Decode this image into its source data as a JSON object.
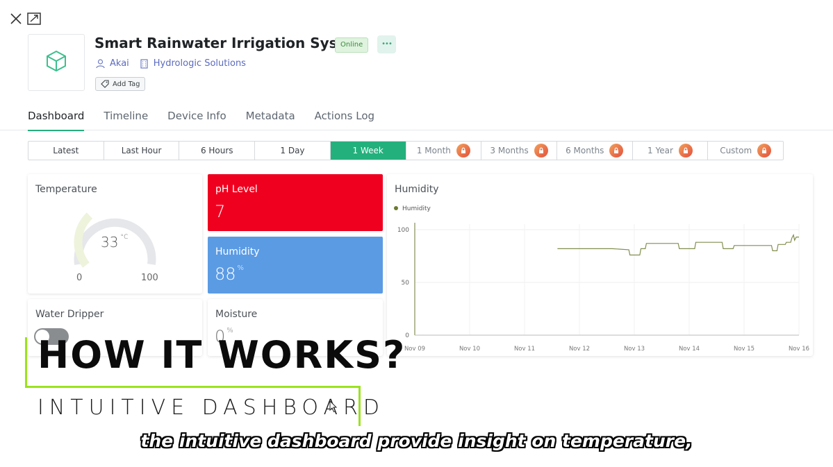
{
  "window_controls": {
    "close_icon": "close-icon",
    "expand_icon": "expand-icon"
  },
  "device": {
    "title": "Smart Rainwater Irrigation System",
    "status": "Online",
    "owner": "Akai",
    "organization": "Hydrologic Solutions",
    "add_tag_label": "Add Tag",
    "more_label": "•••",
    "icon": "cube-icon"
  },
  "tabs": [
    {
      "label": "Dashboard",
      "active": true
    },
    {
      "label": "Timeline"
    },
    {
      "label": "Device Info"
    },
    {
      "label": "Metadata"
    },
    {
      "label": "Actions Log"
    }
  ],
  "time_ranges": [
    {
      "label": "Latest"
    },
    {
      "label": "Last Hour"
    },
    {
      "label": "6 Hours"
    },
    {
      "label": "1 Day"
    },
    {
      "label": "1 Week",
      "active": true
    },
    {
      "label": "1 Month",
      "locked": true
    },
    {
      "label": "3 Months",
      "locked": true
    },
    {
      "label": "6 Months",
      "locked": true
    },
    {
      "label": "1 Year",
      "locked": true
    },
    {
      "label": "Custom",
      "locked": true
    }
  ],
  "widgets": {
    "temperature": {
      "title": "Temperature",
      "value": "33",
      "unit": "°C",
      "min": "0",
      "max": "100",
      "level": 0.33
    },
    "ph": {
      "title": "pH Level",
      "value": "7",
      "color": "#f0001f"
    },
    "humidity_tile": {
      "title": "Humidity",
      "value": "88",
      "unit": "%",
      "color": "#5b9be4"
    },
    "water_dripper": {
      "title": "Water Dripper",
      "on": false
    },
    "moisture": {
      "title": "Moisture",
      "value": "0",
      "unit": "%"
    }
  },
  "chart_data": {
    "type": "line",
    "title": "Humidity",
    "series": [
      {
        "name": "Humidity",
        "color": "#6b7a2f",
        "points": [
          [
            2.6,
            82
          ],
          [
            3.1,
            82
          ],
          [
            3.6,
            82
          ],
          [
            3.9,
            81
          ],
          [
            3.92,
            76
          ],
          [
            4.1,
            76
          ],
          [
            4.12,
            82
          ],
          [
            4.2,
            82
          ],
          [
            4.22,
            87
          ],
          [
            4.8,
            87
          ],
          [
            4.82,
            82
          ],
          [
            5.1,
            82
          ],
          [
            5.12,
            88
          ],
          [
            5.6,
            88
          ],
          [
            5.62,
            82
          ],
          [
            5.8,
            82
          ],
          [
            5.82,
            85
          ],
          [
            6.2,
            85
          ],
          [
            6.5,
            85
          ],
          [
            6.52,
            80
          ],
          [
            6.6,
            80
          ],
          [
            6.62,
            86
          ],
          [
            6.75,
            86
          ],
          [
            6.77,
            88
          ],
          [
            6.85,
            88
          ],
          [
            6.87,
            92
          ],
          [
            6.9,
            95
          ],
          [
            6.92,
            90
          ],
          [
            6.95,
            93
          ],
          [
            7.0,
            93
          ]
        ]
      }
    ],
    "x_labels": [
      "Nov 09",
      "Nov 10",
      "Nov 11",
      "Nov 12",
      "Nov 13",
      "Nov 14",
      "Nov 15",
      "Nov 16"
    ],
    "y_ticks": [
      "0",
      "50",
      "100"
    ],
    "ylim": [
      0,
      100
    ],
    "legend_position": "top-left",
    "grid": true
  },
  "overlay": {
    "heading": "HOW IT WORKS?",
    "subheading": "INTUITIVE DASHBOARD",
    "caption": "the intuitive dashboard provide insight on temperature,",
    "accent_color": "#9be21c"
  }
}
